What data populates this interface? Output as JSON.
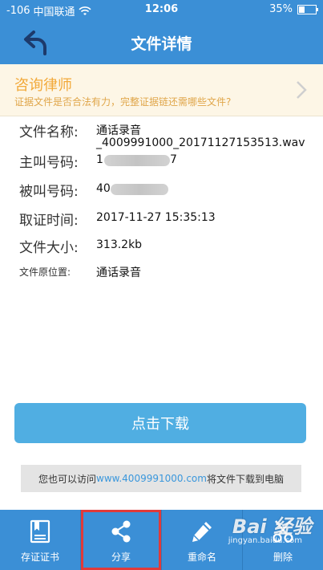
{
  "status_bar": {
    "signal": "-106",
    "carrier": "中国联通",
    "time": "12:06",
    "battery": "35%",
    "battery_level": 0.35
  },
  "nav": {
    "title": "文件详情",
    "back_icon": "back-arrow-icon"
  },
  "consult": {
    "title": "咨询律师",
    "subtitle": "证据文件是否合法有力，完整证据链还需哪些文件?"
  },
  "info": {
    "file_name_label": "文件名称:",
    "file_name_line1": "通话录音",
    "file_name_line2": "_4009991000_20171127153513.wav",
    "caller_label": "主叫号码:",
    "caller_prefix": "1",
    "caller_suffix": "7",
    "callee_label": "被叫号码:",
    "callee_prefix": "40",
    "time_label": "取证时间:",
    "time_value": "2017-11-27 15:35:13",
    "size_label": "文件大小:",
    "size_value": "313.2kb",
    "location_label": "文件原位置:",
    "location_value": "通话录音"
  },
  "download_button": "点击下载",
  "tip": {
    "prefix": "您也可以访问",
    "link": "www.4009991000.com",
    "suffix": "将文件下载到电脑"
  },
  "tabs": [
    {
      "label": "存证证书",
      "icon": "certificate-icon"
    },
    {
      "label": "分享",
      "icon": "share-icon"
    },
    {
      "label": "重命名",
      "icon": "pencil-icon"
    },
    {
      "label": "删除",
      "icon": "scissors-icon"
    }
  ],
  "watermark": {
    "text": "Bai 经验",
    "sub": "jingyan.baidu.com"
  },
  "colors": {
    "primary": "#3b8fd6",
    "consult_text": "#f2a93a",
    "download": "#50aee2",
    "link": "#3a97dc",
    "highlight": "#e03a3a"
  }
}
